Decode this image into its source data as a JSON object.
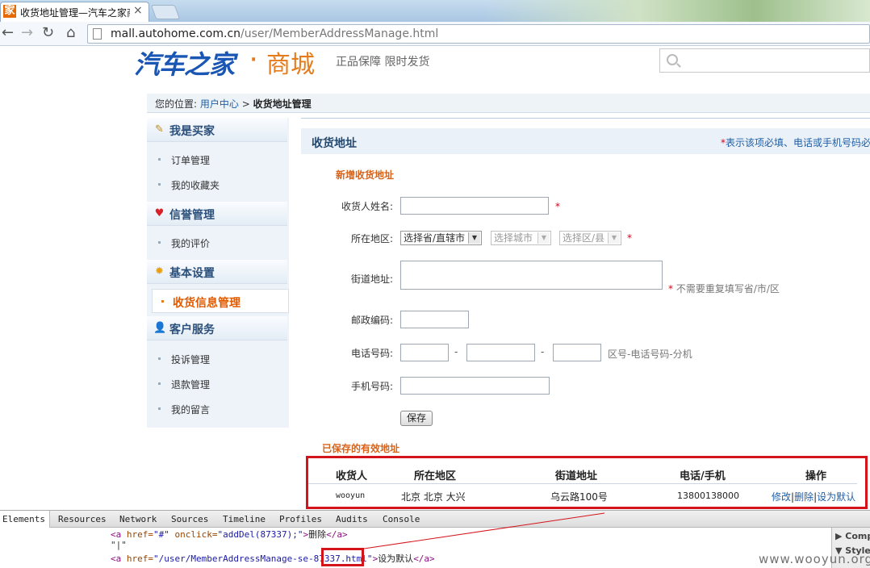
{
  "browser": {
    "tab_title": "收货地址管理—汽车之家商城",
    "tab_favicon": "家",
    "url_host": "mall.autohome.com.cn",
    "url_path": "/user/MemberAddressManage.html"
  },
  "header": {
    "logo_main": "汽车之家",
    "logo_dot": "·",
    "logo_sub": "商城",
    "slogan": "正品保障 限时发货"
  },
  "breadcrumb": {
    "prefix": "您的位置:",
    "link": "用户中心",
    "sep": ">",
    "current": "收货地址管理"
  },
  "sidebar": {
    "groups": [
      {
        "title": "我是买家",
        "icon": "edit-icon",
        "items": [
          "订单管理",
          "我的收藏夹"
        ]
      },
      {
        "title": "信誉管理",
        "icon": "heart-icon",
        "items": [
          "我的评价"
        ]
      },
      {
        "title": "基本设置",
        "icon": "sun-icon",
        "items": [
          "收货信息管理"
        ]
      },
      {
        "title": "客户服务",
        "icon": "person-icon",
        "items": [
          "投诉管理",
          "退款管理",
          "我的留言"
        ]
      }
    ],
    "active": "收货信息管理"
  },
  "main": {
    "title": "收货地址",
    "note_star": "*",
    "note": "表示该项必填、电话或手机号码必",
    "new_section": "新增收货地址",
    "form": {
      "name_label": "收货人姓名:",
      "region_label": "所在地区:",
      "province": "选择省/直辖市",
      "city": "选择城市",
      "district": "选择区/县",
      "street_label": "街道地址:",
      "street_hint": "不需要重复填写省/市/区",
      "zip_label": "邮政编码:",
      "phone_label": "电话号码:",
      "phone_hint": "区号-电话号码-分机",
      "mobile_label": "手机号码:",
      "dash": "-",
      "required": "*",
      "save": "保存"
    },
    "saved_section": "已保存的有效地址",
    "table": {
      "headers": [
        "收货人",
        "所在地区",
        "街道地址",
        "电话/手机",
        "操作"
      ],
      "rows": [
        {
          "name": "wooyun",
          "region": "北京 北京 大兴",
          "street": "乌云路100号",
          "phone": "13800138000",
          "op_edit": "修改",
          "op_delete": "删除",
          "op_default": "设为默认",
          "op_sep": "|"
        }
      ]
    }
  },
  "devtools": {
    "tabs": [
      "Elements",
      "Resources",
      "Network",
      "Sources",
      "Timeline",
      "Profiles",
      "Audits",
      "Console"
    ],
    "line1": {
      "open": "<a",
      "attr1": " href=",
      "val1": "\"#\"",
      "attr2": " onclick=",
      "val2": "\"addDel(87337);\"",
      "close": ">",
      "text": "删除",
      "end": "</a>"
    },
    "line2": "\"|\"",
    "line3": {
      "open": "<a",
      "attr1": " href=",
      "val1_a": "\"/user/MemberAddressManage-se",
      "val1_b": "-87337",
      "val1_c": ".html\"",
      "close": ">",
      "text": "设为默认",
      "end": "</a>"
    },
    "side_1": "Comp",
    "side_2": "Styles"
  },
  "watermark": "www.wooyun.org"
}
